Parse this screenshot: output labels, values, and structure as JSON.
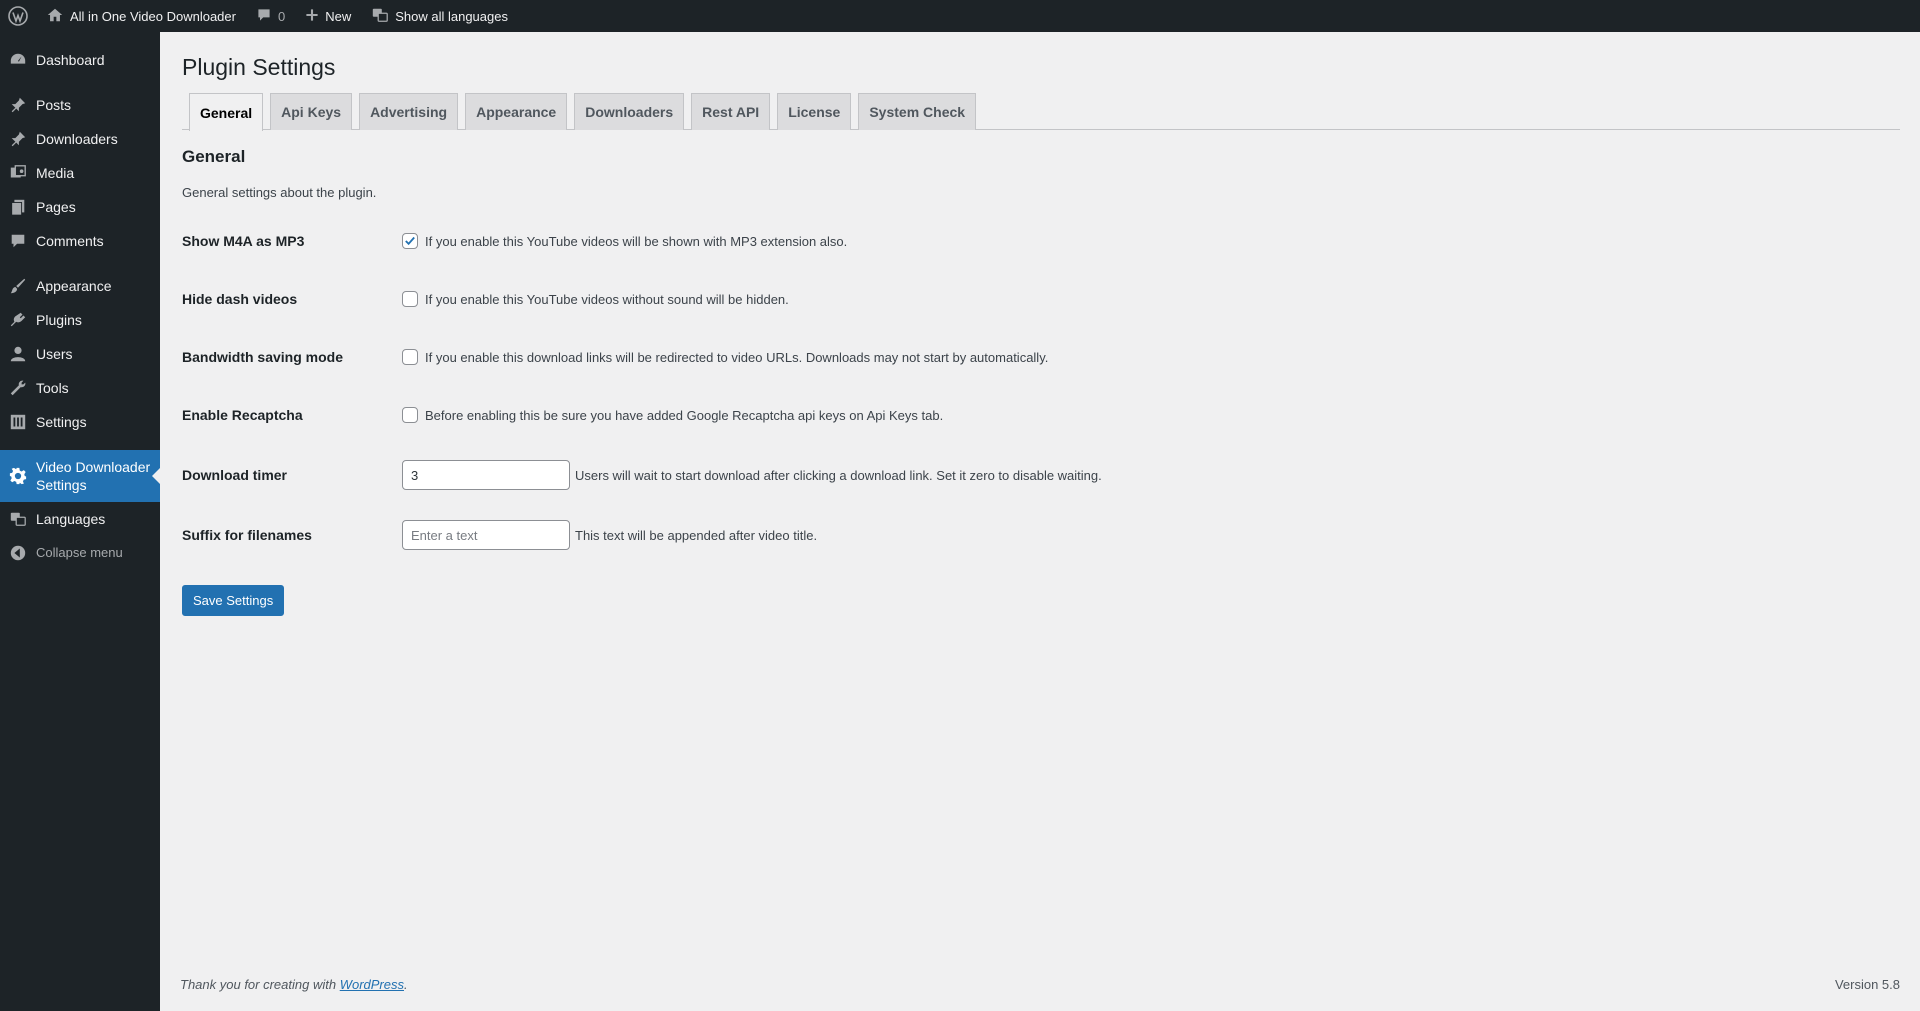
{
  "adminbar": {
    "site_name": "All in One Video Downloader",
    "comments_count": "0",
    "new_label": "New",
    "languages_label": "Show all languages"
  },
  "sidebar": {
    "items": [
      {
        "label": "Dashboard",
        "icon": "dashboard-icon"
      },
      {
        "label": "Posts",
        "icon": "pin-icon"
      },
      {
        "label": "Downloaders",
        "icon": "pin-icon"
      },
      {
        "label": "Media",
        "icon": "media-icon"
      },
      {
        "label": "Pages",
        "icon": "pages-icon"
      },
      {
        "label": "Comments",
        "icon": "comment-icon"
      },
      {
        "label": "Appearance",
        "icon": "brush-icon"
      },
      {
        "label": "Plugins",
        "icon": "plugin-icon"
      },
      {
        "label": "Users",
        "icon": "user-icon"
      },
      {
        "label": "Tools",
        "icon": "wrench-icon"
      },
      {
        "label": "Settings",
        "icon": "settings-icon"
      },
      {
        "label": "Video Downloader Settings",
        "icon": "gear-icon",
        "current": true
      },
      {
        "label": "Languages",
        "icon": "translate-icon"
      }
    ],
    "collapse_label": "Collapse menu"
  },
  "page": {
    "title": "Plugin Settings",
    "tabs": [
      "General",
      "Api Keys",
      "Advertising",
      "Appearance",
      "Downloaders",
      "Rest API",
      "License",
      "System Check"
    ],
    "active_tab": "General",
    "section_title": "General",
    "section_desc": "General settings about the plugin."
  },
  "settings": {
    "show_m4a": {
      "label": "Show M4A as MP3",
      "checked": true,
      "hint": "If you enable this YouTube videos will be shown with MP3 extension also."
    },
    "hide_dash": {
      "label": "Hide dash videos",
      "checked": false,
      "hint": "If you enable this YouTube videos without sound will be hidden."
    },
    "bandwidth": {
      "label": "Bandwidth saving mode",
      "checked": false,
      "hint": "If you enable this download links will be redirected to video URLs. Downloads may not start by automatically."
    },
    "recaptcha": {
      "label": "Enable Recaptcha",
      "checked": false,
      "hint": "Before enabling this be sure you have added Google Recaptcha api keys on Api Keys tab."
    },
    "timer": {
      "label": "Download timer",
      "value": "3",
      "hint": "Users will wait to start download after clicking a download link. Set it zero to disable waiting."
    },
    "suffix": {
      "label": "Suffix for filenames",
      "value": "",
      "placeholder": "Enter a text",
      "hint": "This text will be appended after video title."
    }
  },
  "save_label": "Save Settings",
  "footer": {
    "thanks_prefix": "Thank you for creating with ",
    "thanks_link": "WordPress",
    "thanks_suffix": ".",
    "version": "Version 5.8"
  },
  "colors": {
    "accent": "#2271b1",
    "admin_dark": "#1d2327",
    "background": "#f0f0f1"
  }
}
